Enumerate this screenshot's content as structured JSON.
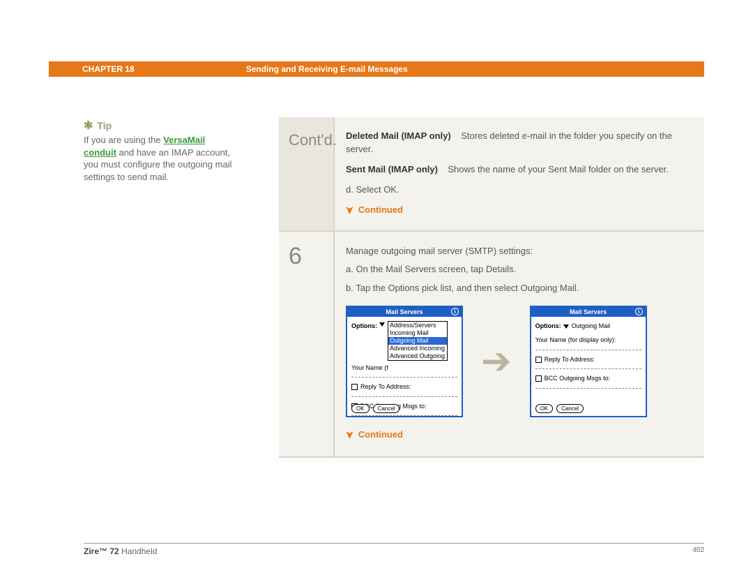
{
  "header": {
    "chapter_label": "CHAPTER 18",
    "title": "Sending and Receiving E-mail Messages"
  },
  "sidebar": {
    "tip_label": "Tip",
    "tip_text_1": "If you are using the ",
    "tip_link": "VersaMail conduit",
    "tip_text_2": " and have an IMAP account, you must configure the outgoing mail settings to send mail."
  },
  "row1": {
    "step_label": "Cont'd.",
    "defn1_term": "Deleted Mail (IMAP only)",
    "defn1_desc": "Stores deleted e-mail in the folder you specify on the server.",
    "defn2_term": "Sent Mail (IMAP only)",
    "defn2_desc": "Shows the name of your Sent Mail folder on the server.",
    "sub_d": "d.  Select OK.",
    "continued": "Continued"
  },
  "row2": {
    "step_num": "6",
    "line1": "Manage outgoing mail server (SMTP) settings:",
    "line_a": "a.  On the Mail Servers screen, tap Details.",
    "line_b": "b.  Tap the Options pick list, and then select Outgoing Mail.",
    "continued": "Continued"
  },
  "palm_left": {
    "title": "Mail Servers",
    "options_label": "Options:",
    "dropdown": [
      "Address/Servers",
      "Incoming Mail",
      "Outgoing Mail",
      "Advanced Incoming",
      "Advanced Outgoing"
    ],
    "selected_index": 2,
    "name_row": "Your Name (f",
    "reply": "Reply To Address:",
    "bcc": "BCC Outgoing Msgs to:",
    "ok": "OK",
    "cancel": "Cancel"
  },
  "palm_right": {
    "title": "Mail Servers",
    "options_label": "Options:",
    "option_value": "Outgoing Mail",
    "name_row": "Your Name (for display only):",
    "reply": "Reply To Address:",
    "bcc": "BCC Outgoing Msgs to:",
    "ok": "OK",
    "cancel": "Cancel"
  },
  "footer": {
    "product_bold": "Zire™ 72",
    "product_rest": " Handheld",
    "page": "402"
  }
}
